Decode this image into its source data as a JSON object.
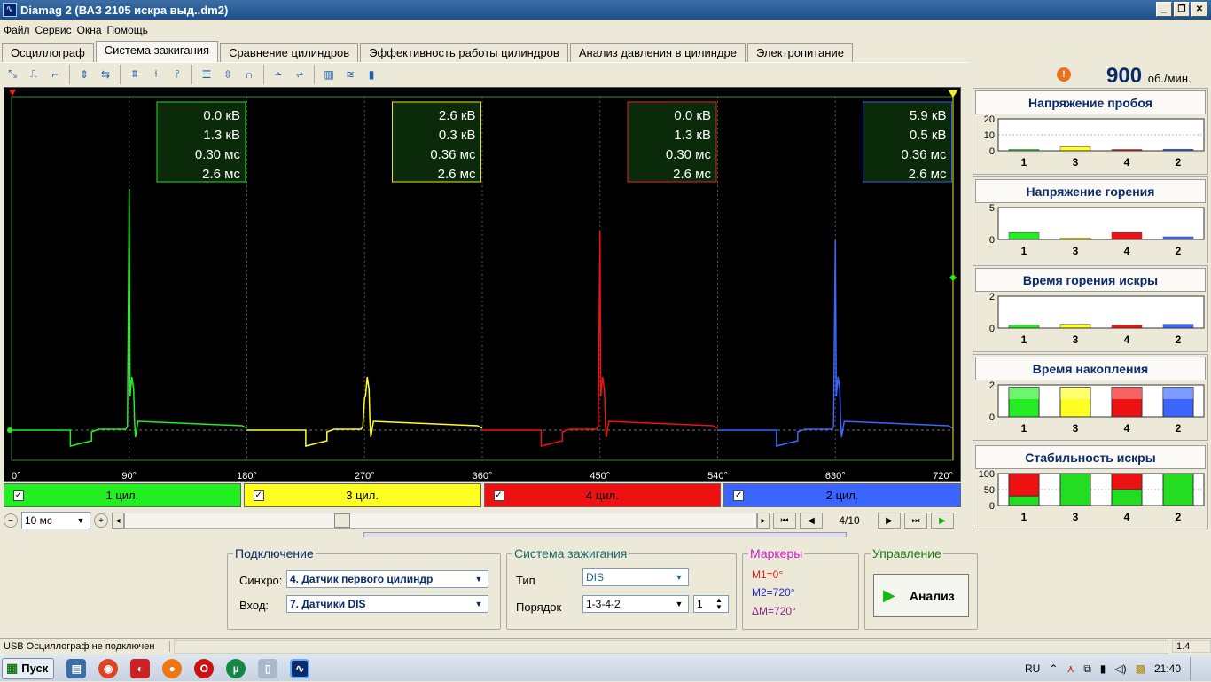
{
  "title": "Diamag 2 (ВАЗ 2105 искра выд..dm2)",
  "window_buttons": [
    "_",
    "❐",
    "✕"
  ],
  "menu": [
    "Файл",
    "Сервис",
    "Окна",
    "Помощь"
  ],
  "tabs": [
    "Осциллограф",
    "Система зажигания",
    "Сравнение цилиндров",
    "Эффективность работы цилиндров",
    "Анализ давления в цилиндре",
    "Электропитание"
  ],
  "active_tab": 1,
  "rpm": {
    "value": "900",
    "unit": "об./мин."
  },
  "scope": {
    "x_ticks": [
      "0°",
      "90°",
      "180°",
      "270°",
      "360°",
      "450°",
      "540°",
      "630°",
      "720°"
    ],
    "boxes": [
      {
        "color": "#22dd22",
        "lines": [
          "0.0 кВ",
          "1.3 кВ",
          "0.30 мс",
          "2.6 мс"
        ]
      },
      {
        "color": "#e6e620",
        "lines": [
          "2.6 кВ",
          "0.3 кВ",
          "0.36 мс",
          "2.6 мс"
        ]
      },
      {
        "color": "#ee2020",
        "lines": [
          "0.0 кВ",
          "1.3 кВ",
          "0.30 мс",
          "2.6 мс"
        ]
      },
      {
        "color": "#3a5cee",
        "lines": [
          "5.9 кВ",
          "0.5 кВ",
          "0.36 мс",
          "2.6 мс"
        ]
      }
    ],
    "peaks": [
      1.0,
      0.1,
      0.82,
      0.78
    ]
  },
  "channels": [
    {
      "label": "1 цил.",
      "color": "#22ee22",
      "checked": "✓"
    },
    {
      "label": "3 цил.",
      "color": "#ffff22",
      "checked": "✓"
    },
    {
      "label": "4 цил.",
      "color": "#ee1111",
      "checked": "✓"
    },
    {
      "label": "2 цил.",
      "color": "#3a66ff",
      "checked": "✓"
    }
  ],
  "nav": {
    "timebase": "10 мс",
    "page": "4/10"
  },
  "metrics": [
    {
      "title": "Напряжение пробоя",
      "yticks": [
        "20",
        "10",
        "0"
      ],
      "ymax": 20,
      "values": [
        0.0,
        2.6,
        0.0,
        1.0
      ],
      "style": "line"
    },
    {
      "title": "Напряжение горения",
      "yticks": [
        "5",
        "0"
      ],
      "ymax": 6,
      "values": [
        1.3,
        0.3,
        1.3,
        0.5
      ],
      "style": "line"
    },
    {
      "title": "Время горения искры",
      "yticks": [
        "2",
        "0"
      ],
      "ymax": 3,
      "values": [
        0.3,
        0.36,
        0.3,
        0.36
      ],
      "style": "line"
    },
    {
      "title": "Время накопления",
      "yticks": [
        "2",
        "0"
      ],
      "ymax": 2.8,
      "values": [
        2.6,
        2.6,
        2.6,
        2.6
      ],
      "style": "bar"
    },
    {
      "title": "Стабильность искры",
      "yticks": [
        "100",
        "50",
        "0"
      ],
      "ymax": 100,
      "values": [
        30,
        100,
        50,
        100
      ],
      "style": "stab"
    }
  ],
  "metric_categories": [
    "1",
    "3",
    "4",
    "2"
  ],
  "connection": {
    "title": "Подключение",
    "sync_label": "Синхро:",
    "sync_value": "4.  Датчик первого цилиндр",
    "input_label": "Вход:",
    "input_value": "7.  Датчики DIS"
  },
  "ignition": {
    "title": "Система зажигания",
    "type_label": "Тип",
    "type_value": "DIS",
    "order_label": "Порядок",
    "order_value": "1-3-4-2",
    "order_spin": "1"
  },
  "markers": {
    "title": "Маркеры",
    "m1": "M1=0°",
    "m2": "M2=720°",
    "dm": "ΔM=720°"
  },
  "control": {
    "title": "Управление",
    "analyze_label": "Анализ"
  },
  "status": {
    "left": "USB Осциллограф не подключен",
    "right": "1.4"
  },
  "taskbar": {
    "start": "Пуск",
    "lang": "RU",
    "time": "21:40"
  }
}
